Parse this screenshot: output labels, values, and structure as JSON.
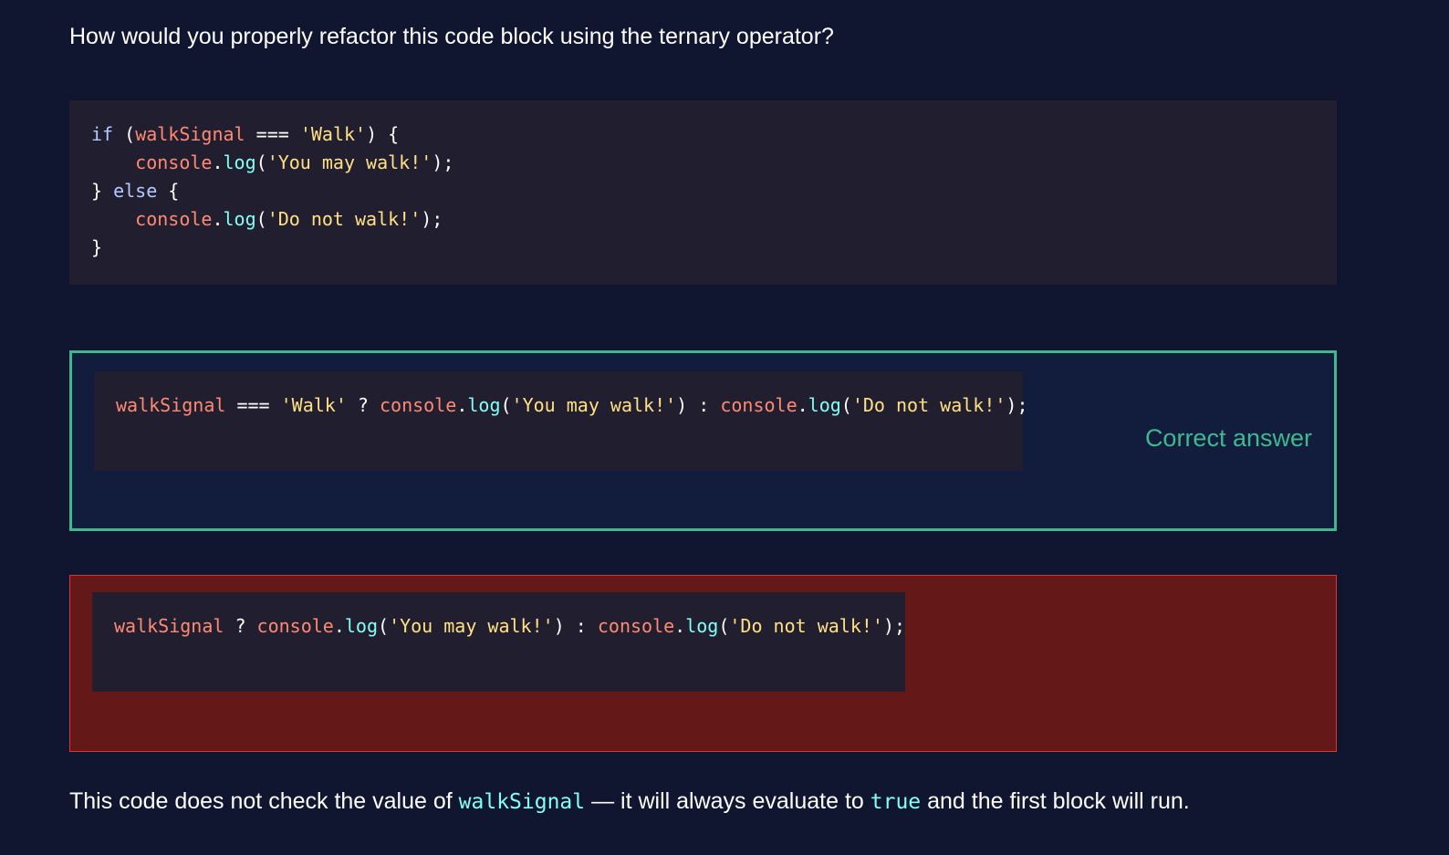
{
  "question": {
    "text": "How would you properly refactor this code block using the ternary operator?"
  },
  "code_block": {
    "lines": [
      [
        "if",
        " (",
        "walkSignal",
        " === ",
        "'Walk'",
        ") {"
      ],
      [
        "    ",
        "console",
        ".",
        "log",
        "(",
        "'You may walk!'",
        ");"
      ],
      [
        "} ",
        "else",
        " {"
      ],
      [
        "    ",
        "console",
        ".",
        "log",
        "(",
        "'Do not walk!'",
        ");"
      ],
      [
        "}"
      ]
    ]
  },
  "answers": [
    {
      "tokens": [
        "walkSignal",
        " === ",
        "'Walk'",
        " ? ",
        "console",
        ".",
        "log",
        "(",
        "'You may walk!'",
        ") : ",
        "console",
        ".",
        "log",
        "(",
        "'Do not walk!'",
        ");"
      ],
      "status_label": "Correct answer"
    },
    {
      "tokens": [
        "walkSignal",
        " ? ",
        "console",
        ".",
        "log",
        "(",
        "'You may walk!'",
        ") : ",
        "console",
        ".",
        "log",
        "(",
        "'Do not walk!'",
        ");"
      ]
    }
  ],
  "explanation": {
    "part1": "This code does not check the value of ",
    "code1": "walkSignal",
    "part2": " — it will always evaluate to ",
    "code2": "true",
    "part3": " and the first block will run."
  },
  "colors": {
    "background": "#10162f",
    "code_background": "#211f2f",
    "correct_border": "#3fb88e",
    "wrong_background": "#651818",
    "keyword": "#b3ccff",
    "variable": "#ff8973",
    "string": "#ffe083",
    "function": "#83fff5"
  }
}
